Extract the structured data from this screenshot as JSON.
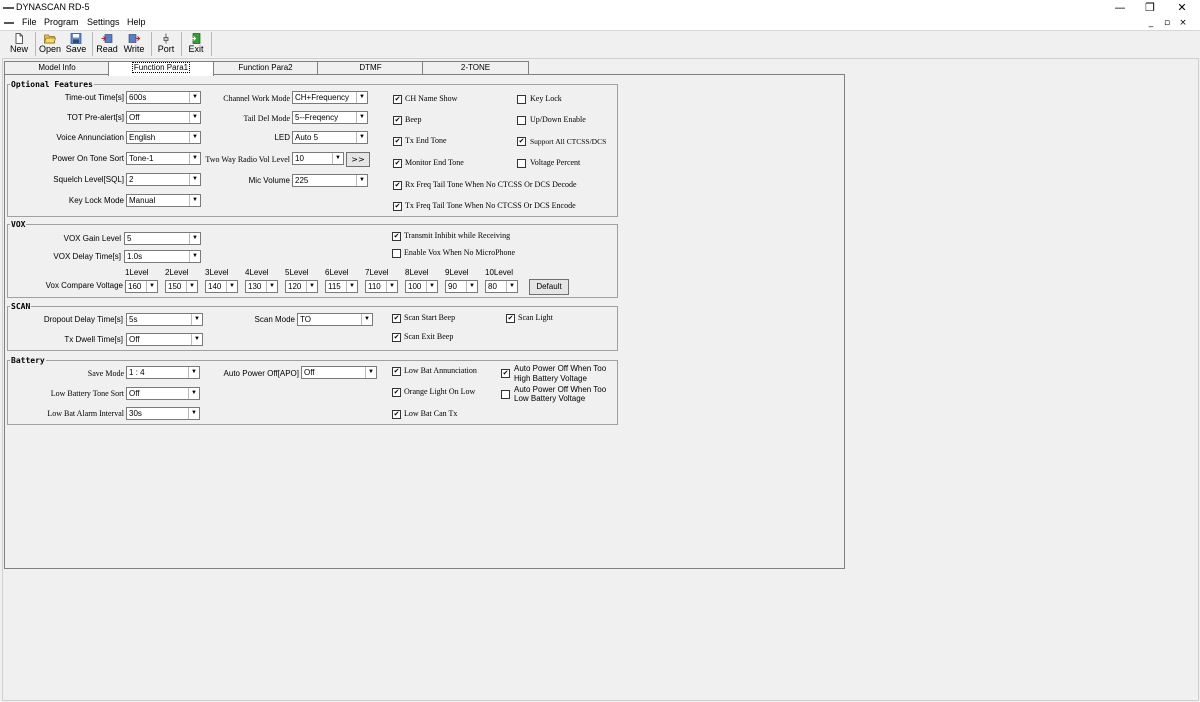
{
  "window": {
    "title": "DYNASCAN RD-5",
    "minimize": "—",
    "restore": "❐",
    "close": "✕"
  },
  "mdi": {
    "minimize": "_",
    "restore": "▫",
    "close": "×"
  },
  "menu": [
    "File",
    "Program",
    "Settings",
    "Help"
  ],
  "toolbar": {
    "new": "New",
    "open": "Open",
    "save": "Save",
    "read": "Read",
    "write": "Write",
    "port": "Port",
    "exit": "Exit"
  },
  "tabs": [
    "Model Info",
    "Function Para1",
    "Function Para2",
    "DTMF",
    "2-TONE"
  ],
  "optional": {
    "title": "Optional Features",
    "timeout_label": "Time-out Time[s]",
    "timeout_value": "600s",
    "tot_label": "TOT Pre-alert[s]",
    "tot_value": "Off",
    "voice_label": "Voice Annunciation",
    "voice_value": "English",
    "poweron_label": "Power On Tone Sort",
    "poweron_value": "Tone-1",
    "squelch_label": "Squelch Level[SQL]",
    "squelch_value": "2",
    "keylock_label": "Key Lock Mode",
    "keylock_value": "Manual",
    "chwork_label": "Channel Work Mode",
    "chwork_value": "CH+Frequency",
    "taildel_label": "Tail Del Mode",
    "taildel_value": "5--Freqency",
    "led_label": "LED",
    "led_value": "Auto 5",
    "twoway_label": "Two Way Radio Vol Level",
    "twoway_value": "10",
    "twoway_btn": ">>",
    "mic_label": "Mic Volume",
    "mic_value": "225",
    "cb": {
      "ch_name": "CH Name Show",
      "beep": "Beep",
      "tx_end": "Tx End Tone",
      "monitor_end": "Monitor End Tone",
      "rx_tail": "Rx Freq Tail Tone When No CTCSS Or DCS Decode",
      "tx_tail": "Tx Freq Tail Tone When No CTCSS Or DCS Encode",
      "key_lock": "Key Lock",
      "updown": "Up/Down Enable",
      "support_all": "Support All CTCSS/DCS",
      "voltage_pct": "Voltage Percent"
    }
  },
  "vox": {
    "title": "VOX",
    "gain_label": "VOX Gain Level",
    "gain_value": "5",
    "delay_label": "VOX Delay Time[s]",
    "delay_value": "1.0s",
    "compare_label": "Vox Compare Voltage",
    "levels": [
      "1Level",
      "2Level",
      "3Level",
      "4Level",
      "5Level",
      "6Level",
      "7Level",
      "8Level",
      "9Level",
      "10Level"
    ],
    "values": [
      "160",
      "150",
      "140",
      "130",
      "120",
      "115",
      "110",
      "100",
      "90",
      "80"
    ],
    "default_btn": "Default",
    "cb_inhibit": "Transmit Inhibit while Receiving",
    "cb_nomic": "Enable Vox When No MicroPhone"
  },
  "scan": {
    "title": "SCAN",
    "dropout_label": "Dropout Delay Time[s]",
    "dropout_value": "5s",
    "txdwell_label": "Tx Dwell Time[s]",
    "txdwell_value": "Off",
    "mode_label": "Scan Mode",
    "mode_value": "TO",
    "cb_start": "Scan Start Beep",
    "cb_exit": "Scan Exit Beep",
    "cb_light": "Scan Light"
  },
  "battery": {
    "title": "Battery",
    "save_label": "Save Mode",
    "save_value": "1 : 4",
    "lowtone_label": "Low Battery Tone Sort",
    "lowtone_value": "Off",
    "alarm_label": "Low Bat Alarm Interval",
    "alarm_value": "30s",
    "apo_label": "Auto Power Off[APO]",
    "apo_value": "Off",
    "cb_lowann": "Low Bat Annunciation",
    "cb_orange": "Orange Light On Low",
    "cb_cantx": "Low Bat Can Tx",
    "cb_high_1": "Auto Power Off When Too",
    "cb_high_2": "High Battery Voltage",
    "cb_lowv_1": "Auto Power Off When Too",
    "cb_lowv_2": "Low Battery Voltage"
  },
  "check": "✔",
  "dropdown_glyph": "▼"
}
